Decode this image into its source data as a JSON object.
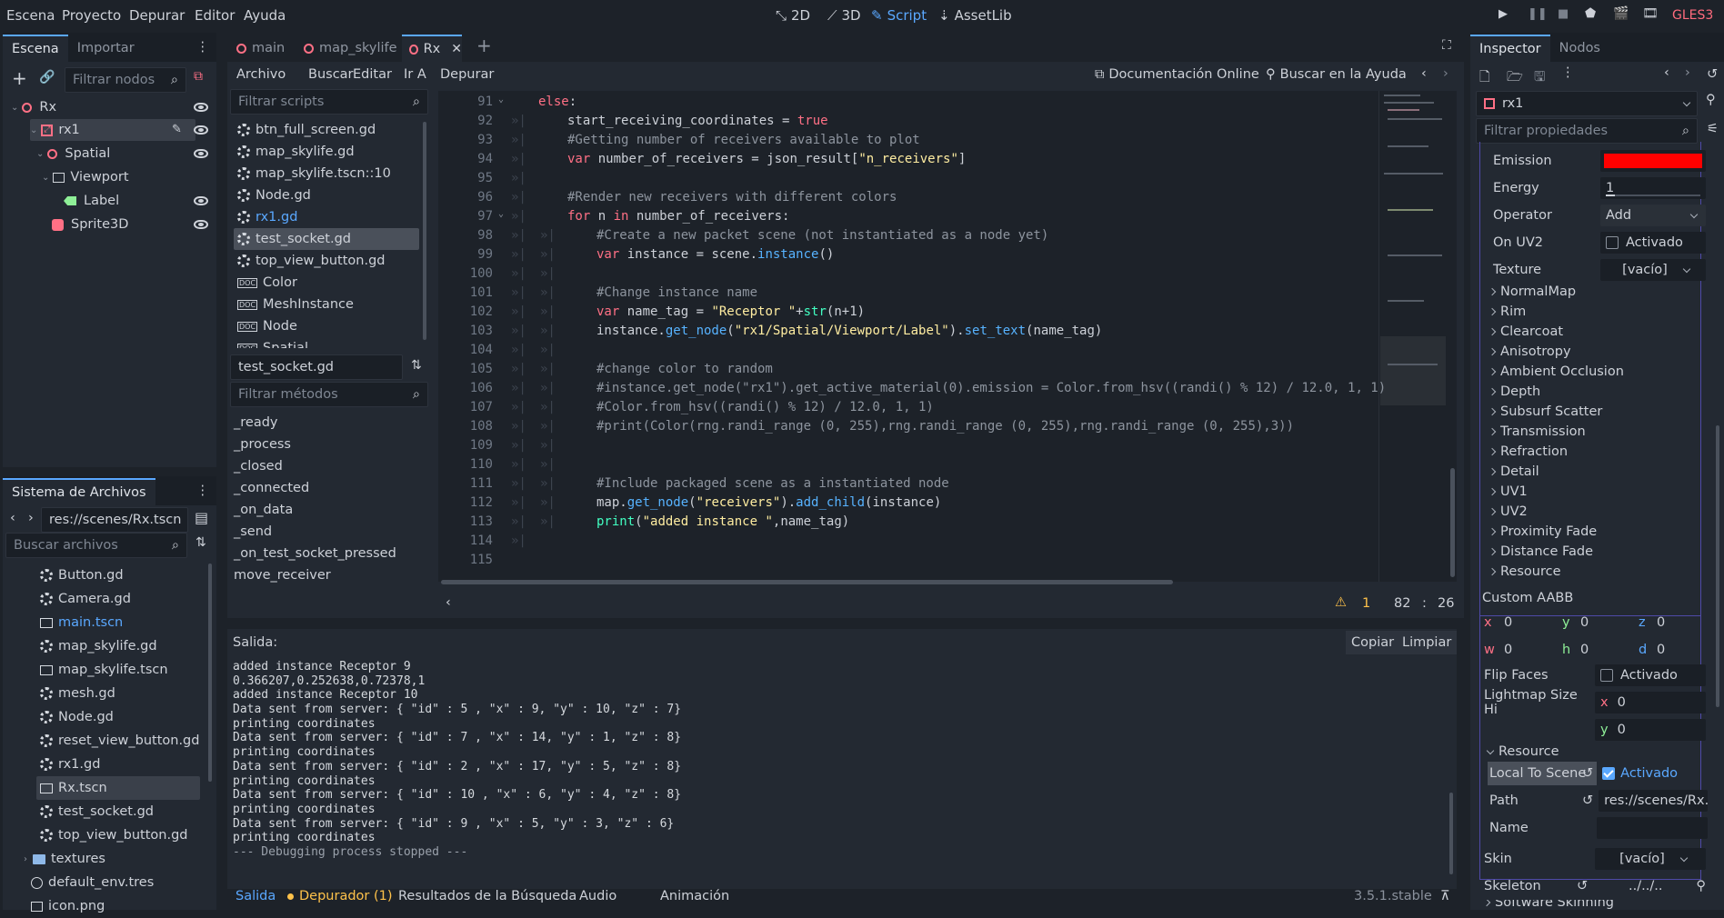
{
  "menu": [
    "Escena",
    "Proyecto",
    "Depurar",
    "Editor",
    "Ayuda"
  ],
  "workspaces": [
    {
      "label": "2D",
      "icon": "2d-icon"
    },
    {
      "label": "3D",
      "icon": "3d-icon"
    },
    {
      "label": "Script",
      "icon": "script-icon",
      "active": true
    },
    {
      "label": "AssetLib",
      "icon": "assetlib-icon"
    }
  ],
  "renderer": "GLES3",
  "scene_dock": {
    "tabs": [
      "Escena",
      "Importar"
    ],
    "filter_placeholder": "Filtrar nodos",
    "tree": [
      {
        "label": "Rx",
        "depth": 0
      },
      {
        "label": "rx1",
        "depth": 1
      },
      {
        "label": "Spatial",
        "depth": 2
      },
      {
        "label": "Viewport",
        "depth": 3
      },
      {
        "label": "Label",
        "depth": 4
      },
      {
        "label": "Sprite3D",
        "depth": 3
      }
    ]
  },
  "filesystem": {
    "title": "Sistema de Archivos",
    "path": "res://scenes/Rx.tscn",
    "search_placeholder": "Buscar archivos",
    "files": [
      "Button.gd",
      "Camera.gd",
      "main.tscn",
      "map_skylife.gd",
      "map_skylife.tscn",
      "mesh.gd",
      "Node.gd",
      "reset_view_button.gd",
      "rx1.gd",
      "Rx.tscn",
      "test_socket.gd",
      "top_view_button.gd",
      "textures",
      "default_env.tres",
      "icon.png"
    ]
  },
  "scene_tabs": [
    "main",
    "map_skylife",
    "Rx"
  ],
  "script_menu": [
    "Archivo",
    "Buscar",
    "Editar",
    "Ir A",
    "Depurar"
  ],
  "doc_online": "Documentación Online",
  "search_help": "Buscar en la Ayuda",
  "scripts_filter": "Filtrar scripts",
  "scripts": [
    "btn_full_screen.gd",
    "map_skylife.gd",
    "map_skylife.tscn::10",
    "Node.gd",
    "rx1.gd",
    "test_socket.gd",
    "top_view_button.gd",
    "Color",
    "MeshInstance",
    "Node",
    "Spatial"
  ],
  "current_script": "test_socket.gd",
  "methods_filter": "Filtrar métodos",
  "methods": [
    "_ready",
    "_process",
    "_closed",
    "_connected",
    "_on_data",
    "_send",
    "_on_test_socket_pressed",
    "move_receiver"
  ],
  "code_start_line": 91,
  "status": {
    "warnings": "1",
    "line": "82",
    "col": "26"
  },
  "output": {
    "title": "Salida:",
    "copy": "Copiar",
    "clear": "Limpiar",
    "lines": [
      "added instance Receptor 9",
      "0.366207,0.252638,0.72378,1",
      "added instance Receptor 10",
      "Data sent from server: { \"id\" : 5 , \"x\" : 9, \"y\" : 10, \"z\" : 7}",
      "printing coordinates",
      "Data sent from server: { \"id\" : 7 , \"x\" : 14, \"y\" : 1, \"z\" : 8}",
      "printing coordinates",
      "Data sent from server: { \"id\" : 2 , \"x\" : 17, \"y\" : 5, \"z\" : 8}",
      "printing coordinates",
      "Data sent from server: { \"id\" : 10 , \"x\" : 6, \"y\" : 4, \"z\" : 8}",
      "printing coordinates",
      "Data sent from server: { \"id\" : 9 , \"x\" : 5, \"y\" : 3, \"z\" : 6}",
      "printing coordinates",
      "--- Debugging process stopped ---"
    ]
  },
  "bottom_tabs": [
    "Salida",
    "Depurador (1)",
    "Resultados de la Búsqueda",
    "Audio",
    "Animación"
  ],
  "version": "3.5.1.stable",
  "inspector": {
    "tabs": [
      "Inspector",
      "Nodos"
    ],
    "object": "rx1",
    "filter_placeholder": "Filtrar propiedades",
    "emission_color": "#ff0000",
    "energy": "1",
    "energy_fraction": 0.1,
    "operator": "Add",
    "on_uv2": "Activado",
    "texture": "[vacío]",
    "sections": [
      "NormalMap",
      "Rim",
      "Clearcoat",
      "Anisotropy",
      "Ambient Occlusion",
      "Depth",
      "Subsurf Scatter",
      "Transmission",
      "Refraction",
      "Detail",
      "UV1",
      "UV2",
      "Proximity Fade",
      "Distance Fade",
      "Resource"
    ],
    "custom_aabb": "Custom AABB",
    "aabb": {
      "x": "0",
      "y": "0",
      "z": "0",
      "w": "0",
      "h": "0",
      "d": "0"
    },
    "flip_faces": "Flip Faces",
    "flip_value": "Activado",
    "lightmap": "Lightmap Size Hi",
    "lightmap_x": "0",
    "lightmap_y": "0",
    "resource": "Resource",
    "local_to_scene": "Local To Scene",
    "local_value": "Activado",
    "path_label": "Path",
    "path_value": "res://scenes/Rx.",
    "name_label": "Name",
    "skin": "Skin",
    "skin_value": "[vacío]",
    "skeleton": "Skeleton",
    "skeleton_value": "../../..",
    "software_skinning": "Software Skinning",
    "labels": {
      "emission": "Emission",
      "energy": "Energy",
      "operator": "Operator",
      "on_uv2": "On UV2",
      "texture": "Texture"
    }
  }
}
